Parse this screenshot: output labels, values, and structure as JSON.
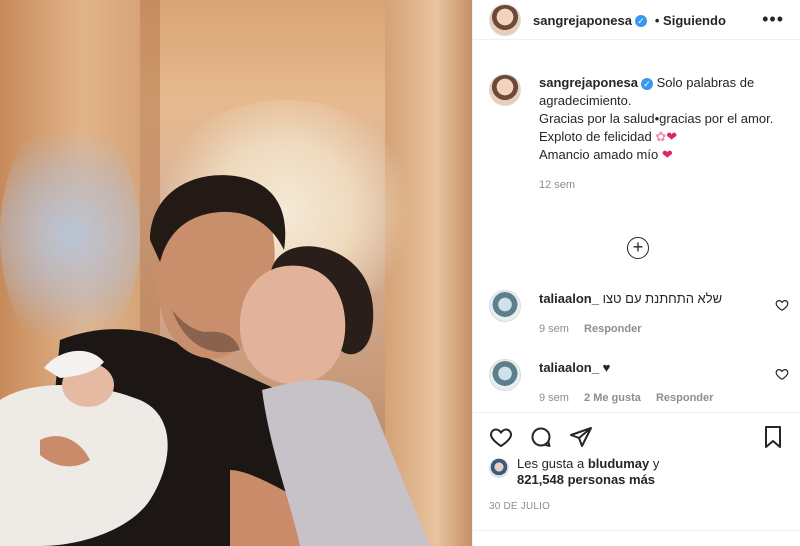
{
  "post": {
    "username": "sangrejaponesa",
    "follow_status": "• Siguiendo",
    "more_icon": "more-horizontal-icon"
  },
  "caption": {
    "username": "sangrejaponesa",
    "line1": "Solo palabras de agradecimiento.",
    "line2": "Gracias por la salud•gracias por el amor.",
    "line3": "Exploto de felicidad",
    "line3_emoji": "✿",
    "line3_heart": "❤",
    "line4": "Amancio amado mío",
    "line4_heart": "❤",
    "time": "12 sem"
  },
  "load_more_icon": "plus-circle-icon",
  "comments": [
    {
      "username": "taliaalon_",
      "text": "שלא התחתנת עם טצו",
      "time": "9 sem",
      "reply": "Responder"
    },
    {
      "username": "taliaalon_",
      "text": "♥",
      "time": "9 sem",
      "likes": "2 Me gusta",
      "reply": "Responder"
    }
  ],
  "likes": {
    "prefix": "Les gusta a",
    "user": "bludumay",
    "mid": "y",
    "count": "821,548 personas más"
  },
  "date": "30 DE JULIO",
  "colors": {
    "verified": "#3897f0",
    "heart": "#e0245e",
    "muted": "#8e8e8e",
    "text": "#262626",
    "border": "#efefef"
  }
}
